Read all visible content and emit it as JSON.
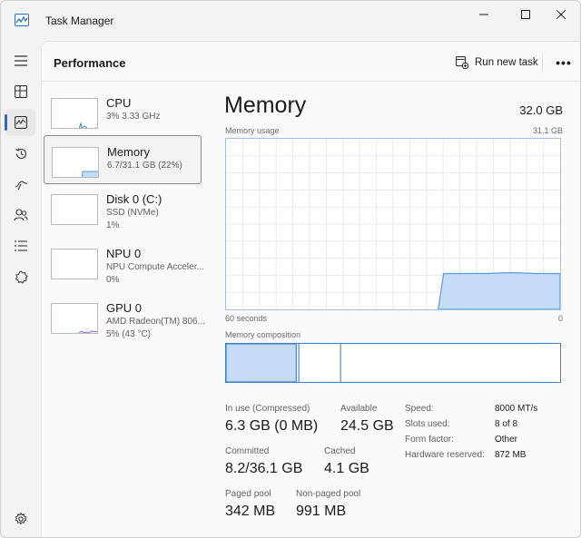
{
  "window": {
    "title": "Task Manager"
  },
  "nav": {
    "items": [
      {
        "name": "hamburger-menu-icon"
      },
      {
        "name": "processes-icon"
      },
      {
        "name": "performance-icon",
        "active": true
      },
      {
        "name": "app-history-icon"
      },
      {
        "name": "startup-apps-icon"
      },
      {
        "name": "users-icon"
      },
      {
        "name": "details-icon"
      },
      {
        "name": "services-icon"
      }
    ],
    "settings": "settings-gear-icon"
  },
  "header": {
    "title": "Performance",
    "run_new_task": "Run new task",
    "more": "•••"
  },
  "devices": [
    {
      "name": "CPU",
      "sub1": "3%  3.33 GHz",
      "sub2": ""
    },
    {
      "name": "Memory",
      "sub1": "6.7/31.1 GB (22%)",
      "sub2": "",
      "selected": true
    },
    {
      "name": "Disk 0 (C:)",
      "sub1": "SSD (NVMe)",
      "sub2": "1%"
    },
    {
      "name": "NPU 0",
      "sub1": "NPU Compute Acceler...",
      "sub2": "0%"
    },
    {
      "name": "GPU 0",
      "sub1": "AMD Radeon(TM) 806...",
      "sub2": "5% (43 °C)"
    }
  ],
  "memory": {
    "title": "Memory",
    "total": "32.0 GB",
    "usage_label": "Memory usage",
    "usage_max": "31.1 GB",
    "time_left": "60 seconds",
    "time_right": "0",
    "composition_label": "Memory composition",
    "usage_fraction": 0.21,
    "composition": {
      "in_use": 0.21,
      "modified": 0.005,
      "standby": 0.125
    }
  },
  "stats": {
    "in_use_label": "In use (Compressed)",
    "in_use_value": "6.3 GB (0 MB)",
    "available_label": "Available",
    "available_value": "24.5 GB",
    "committed_label": "Committed",
    "committed_value": "8.2/36.1 GB",
    "cached_label": "Cached",
    "cached_value": "4.1 GB",
    "paged_label": "Paged pool",
    "paged_value": "342 MB",
    "nonpaged_label": "Non-paged pool",
    "nonpaged_value": "991 MB"
  },
  "specs": {
    "speed_label": "Speed:",
    "speed_value": "8000 MT/s",
    "slots_label": "Slots used:",
    "slots_value": "8 of 8",
    "form_label": "Form factor:",
    "form_value": "Other",
    "reserved_label": "Hardware reserved:",
    "reserved_value": "872 MB"
  },
  "colors": {
    "accent": "#1f6fd1",
    "memory_fill": "#c5dcf7",
    "memory_line": "#5b9be0"
  }
}
